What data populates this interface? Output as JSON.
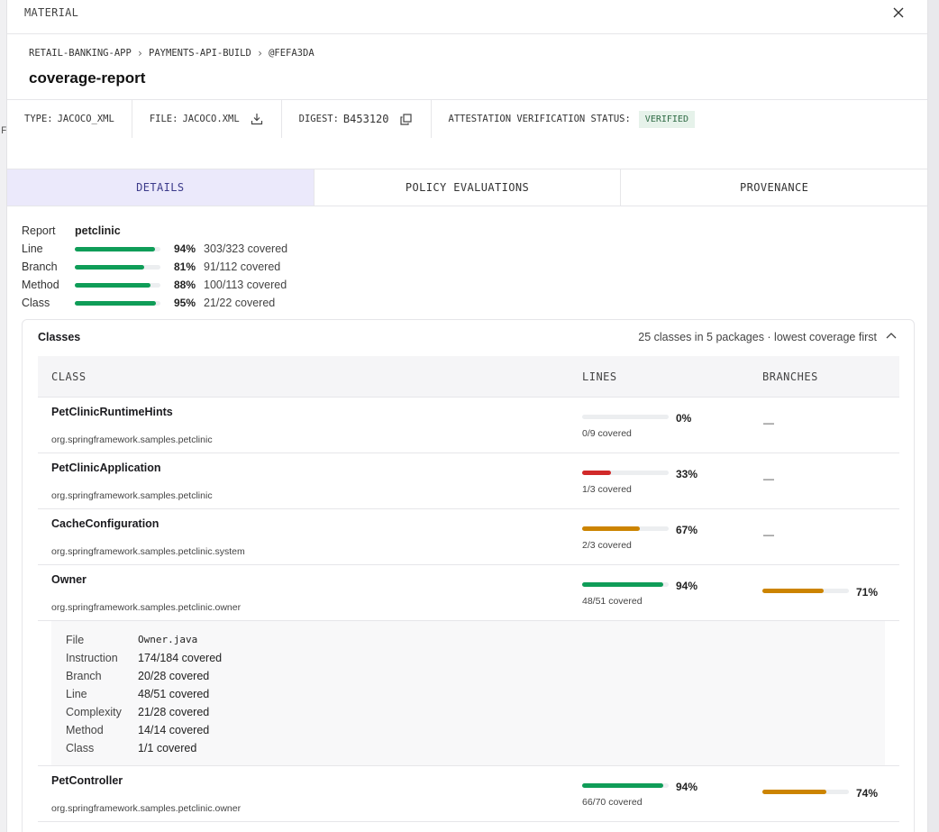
{
  "background": {
    "partial_letter": "F"
  },
  "panel": {
    "title": "MATERIAL",
    "close_icon": "close-icon"
  },
  "breadcrumb": [
    "RETAIL-BANKING-APP",
    "PAYMENTS-API-BUILD",
    "@FEFA3DA"
  ],
  "page_title": "coverage-report",
  "meta": {
    "type_label": "TYPE:",
    "type_value": "JACOCO_XML",
    "file_label": "FILE:",
    "file_value": "JACOCO.XML",
    "digest_label": "DIGEST:",
    "digest_value": "B453120",
    "attestation_label": "ATTESTATION VERIFICATION STATUS:",
    "attestation_value": "VERIFIED"
  },
  "tabs": [
    {
      "label": "DETAILS",
      "active": true
    },
    {
      "label": "POLICY EVALUATIONS",
      "active": false
    },
    {
      "label": "PROVENANCE",
      "active": false
    }
  ],
  "summary": {
    "report_label": "Report",
    "report_value": "petclinic",
    "metrics": [
      {
        "label": "Line",
        "percent": 94,
        "percent_text": "94%",
        "covered": "303/323 covered"
      },
      {
        "label": "Branch",
        "percent": 81,
        "percent_text": "81%",
        "covered": "91/112 covered"
      },
      {
        "label": "Method",
        "percent": 88,
        "percent_text": "88%",
        "covered": "100/113 covered"
      },
      {
        "label": "Class",
        "percent": 95,
        "percent_text": "95%",
        "covered": "21/22 covered"
      }
    ]
  },
  "classes": {
    "title": "Classes",
    "meta": "25 classes in 5 packages · lowest coverage first",
    "headers": {
      "class": "CLASS",
      "lines": "LINES",
      "branches": "BRANCHES"
    },
    "rows": [
      {
        "name": "PetClinicRuntimeHints",
        "package": "org.springframework.samples.petclinic",
        "lines_percent": 0,
        "lines_text": "0%",
        "lines_covered": "0/9 covered",
        "lines_color": "#cccccc",
        "branches": "—"
      },
      {
        "name": "PetClinicApplication",
        "package": "org.springframework.samples.petclinic",
        "lines_percent": 33,
        "lines_text": "33%",
        "lines_covered": "1/3 covered",
        "lines_color": "#d12a2a",
        "branches": "—"
      },
      {
        "name": "CacheConfiguration",
        "package": "org.springframework.samples.petclinic.system",
        "lines_percent": 67,
        "lines_text": "67%",
        "lines_covered": "2/3 covered",
        "lines_color": "#cc8400",
        "branches": "—"
      },
      {
        "name": "Owner",
        "package": "org.springframework.samples.petclinic.owner",
        "lines_percent": 94,
        "lines_text": "94%",
        "lines_covered": "48/51 covered",
        "lines_color": "#0f9d58",
        "branches_percent": 71,
        "branches_text": "71%",
        "branches_color": "#cc8400"
      },
      {
        "name": "PetController",
        "package": "org.springframework.samples.petclinic.owner",
        "lines_percent": 94,
        "lines_text": "94%",
        "lines_covered": "66/70 covered",
        "lines_color": "#0f9d58",
        "branches_percent": 74,
        "branches_text": "74%",
        "branches_color": "#cc8400"
      }
    ],
    "expanded_detail": [
      {
        "key": "File",
        "value": "Owner.java"
      },
      {
        "key": "Instruction",
        "value": "174/184 covered"
      },
      {
        "key": "Branch",
        "value": "20/28 covered"
      },
      {
        "key": "Line",
        "value": "48/51 covered"
      },
      {
        "key": "Complexity",
        "value": "21/28 covered"
      },
      {
        "key": "Method",
        "value": "14/14 covered"
      },
      {
        "key": "Class",
        "value": "1/1 covered"
      }
    ]
  }
}
